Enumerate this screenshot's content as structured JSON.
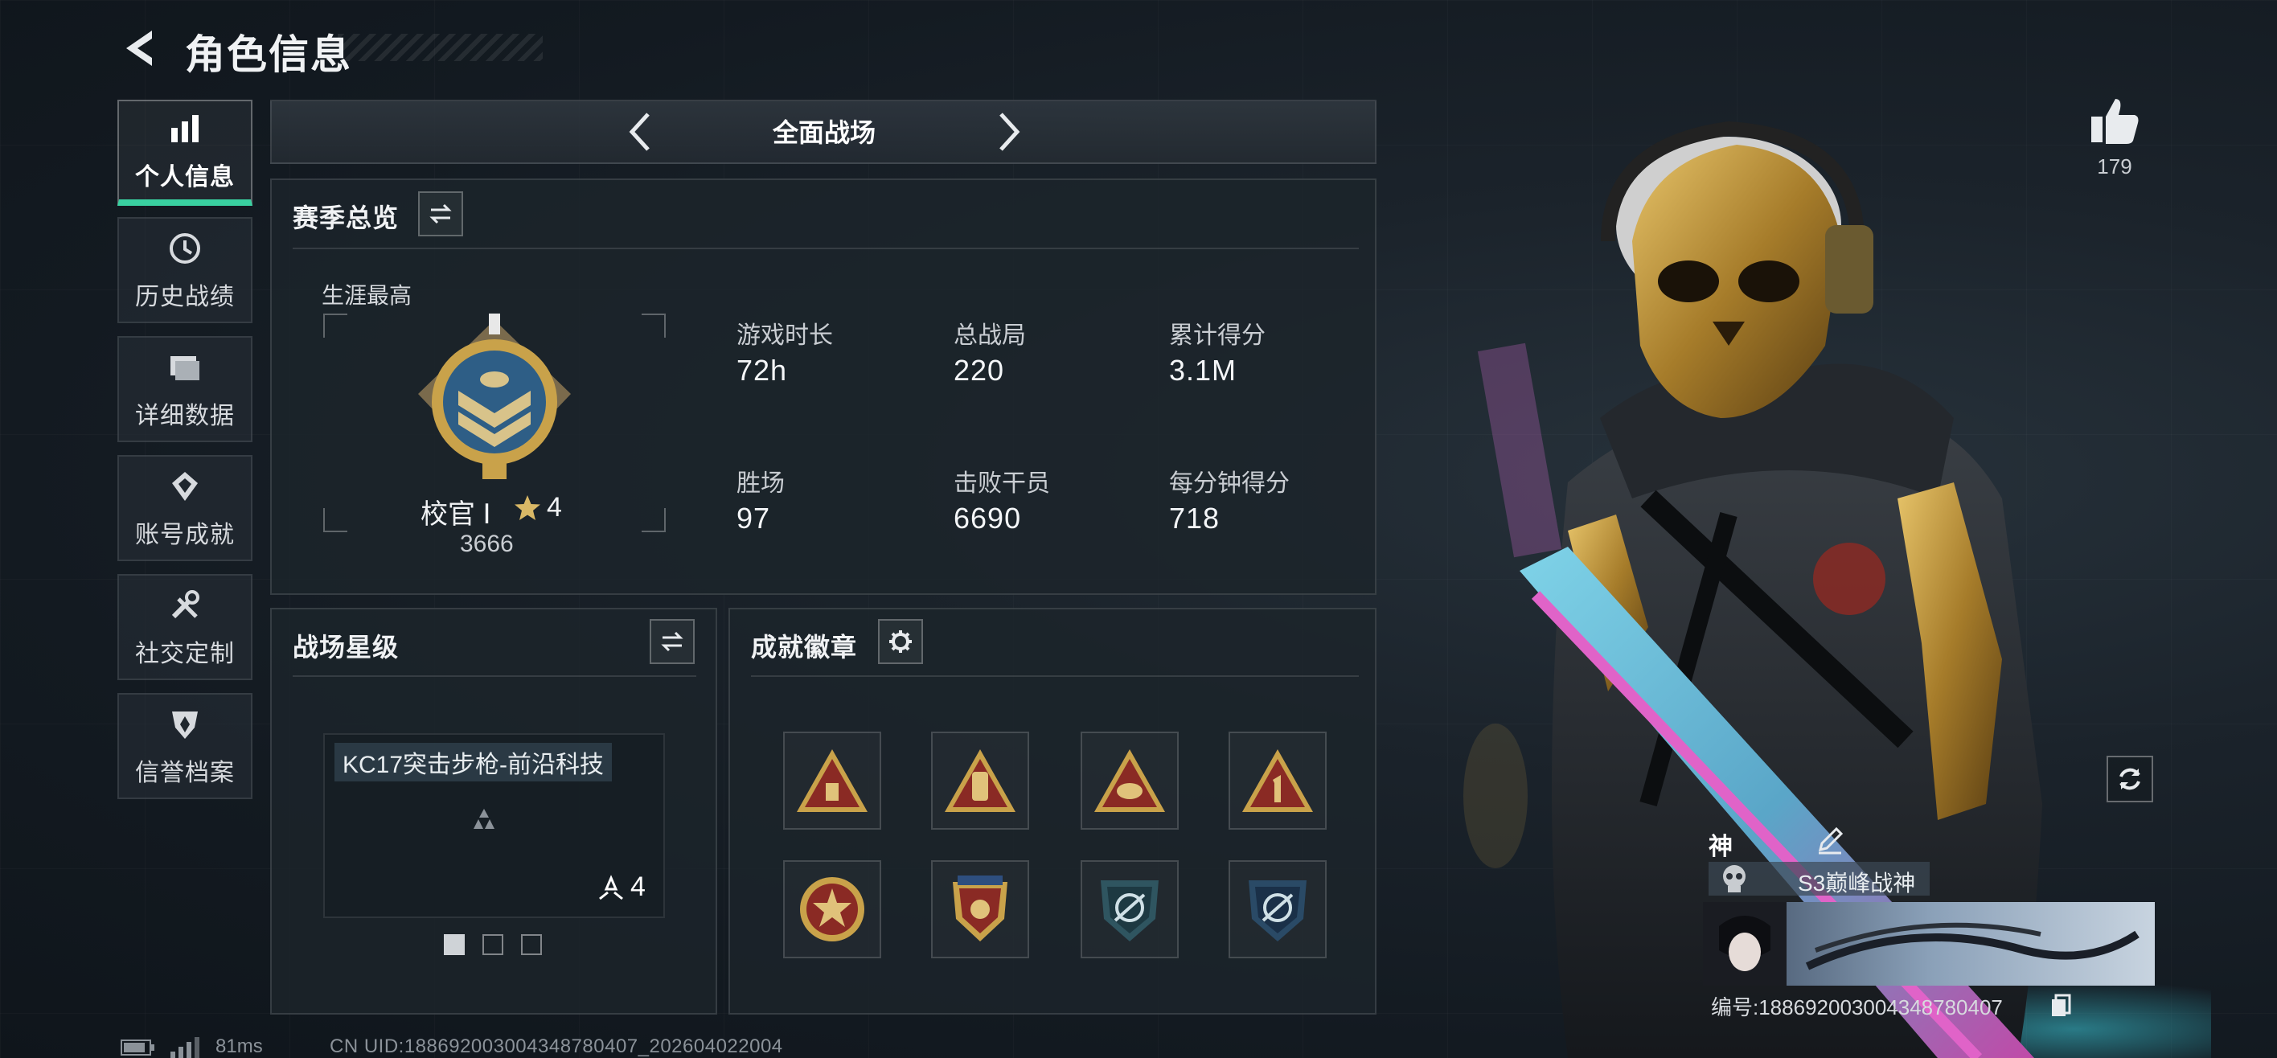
{
  "header": {
    "title": "角色信息"
  },
  "sidebar": {
    "items": [
      {
        "label": "个人信息",
        "icon": "bar-chart-icon",
        "active": true
      },
      {
        "label": "历史战绩",
        "icon": "history-icon",
        "active": false
      },
      {
        "label": "详细数据",
        "icon": "folder-icon",
        "active": false
      },
      {
        "label": "账号成就",
        "icon": "achievement-icon",
        "active": false
      },
      {
        "label": "社交定制",
        "icon": "tools-icon",
        "active": false
      },
      {
        "label": "信誉档案",
        "icon": "shield-icon",
        "active": false
      }
    ]
  },
  "mode_selector": {
    "label": "全面战场"
  },
  "season": {
    "title": "赛季总览",
    "career_label": "生涯最高",
    "rank": {
      "name": "校官 Ⅰ",
      "stars": "4",
      "score": "3666"
    },
    "stats": [
      {
        "label": "游戏时长",
        "value": "72h"
      },
      {
        "label": "总战局",
        "value": "220"
      },
      {
        "label": "累计得分",
        "value": "3.1M"
      },
      {
        "label": "胜场",
        "value": "97"
      },
      {
        "label": "击败干员",
        "value": "6690"
      },
      {
        "label": "每分钟得分",
        "value": "718"
      }
    ]
  },
  "battlefield_stars": {
    "title": "战场星级",
    "weapon": {
      "name": "KC17突击步枪-前沿科技",
      "stars": "4"
    },
    "page_count": 3,
    "current_page": 1
  },
  "achievements": {
    "title": "成就徽章",
    "badges": [
      {
        "icon": "triangle-badge-icon"
      },
      {
        "icon": "triangle-badge-icon"
      },
      {
        "icon": "triangle-badge-icon"
      },
      {
        "icon": "triangle-badge-icon"
      },
      {
        "icon": "round-star-badge-icon"
      },
      {
        "icon": "shield-badge-icon"
      },
      {
        "icon": "emblem-badge-icon"
      },
      {
        "icon": "emblem-badge-icon"
      }
    ]
  },
  "profile": {
    "likes": "179",
    "name": "神",
    "title_badge": "S3巅峰战神",
    "id_text": "编号:188692003004348780407"
  },
  "footer": {
    "ping": "81ms",
    "uid": "CN UID:188692003004348780407_202604022004"
  },
  "colors": {
    "accent": "#39d0a0",
    "gold": "#c9a24a",
    "badge_red": "#8a2a24",
    "panel_bg": "#1c242b"
  }
}
